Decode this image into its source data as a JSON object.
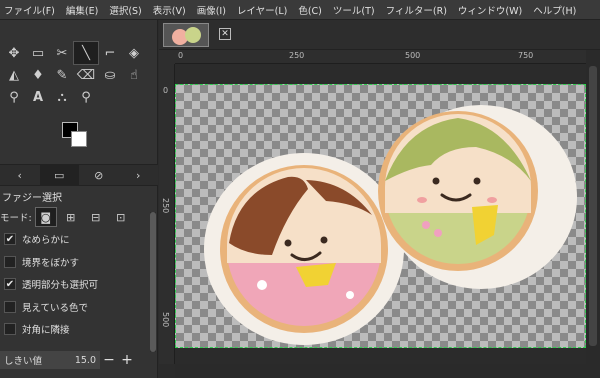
{
  "menubar": {
    "items": [
      "ファイル(F)",
      "編集(E)",
      "選択(S)",
      "表示(V)",
      "画像(I)",
      "レイヤー(L)",
      "色(C)",
      "ツール(T)",
      "フィルター(R)",
      "ウィンドウ(W)",
      "ヘルプ(H)"
    ]
  },
  "toolbox": {
    "tools": [
      [
        "move-tool-icon",
        "rect-select-tool-icon",
        "scissors-tool-icon",
        "measure-tool-icon",
        "crop-tool-icon",
        "transform-tool-icon"
      ],
      [
        "bucket-fill-tool-icon",
        "paintbrush-tool-icon",
        "pencil-tool-icon",
        "eraser-tool-icon",
        "clone-tool-icon",
        "smudge-tool-icon"
      ],
      [
        "paths-tool-icon",
        "text-tool-icon",
        "color-picker-tool-icon",
        "zoom-tool-icon"
      ]
    ],
    "active_tool": "measure-tool-icon"
  },
  "tool_options": {
    "title": "ファジー選択",
    "mode_label": "モード:",
    "checks": [
      {
        "label": "なめらかに",
        "checked": true
      },
      {
        "label": "境界をぼかす",
        "checked": false
      },
      {
        "label": "透明部分も選択可",
        "checked": true
      },
      {
        "label": "見えている色で",
        "checked": false
      },
      {
        "label": "対角に隣接",
        "checked": false
      }
    ],
    "threshold_label": "しきい値",
    "threshold_value": "15.0"
  },
  "ruler": {
    "top_ticks": [
      "0",
      "250",
      "500",
      "750"
    ],
    "left_ticks": [
      "0",
      "250",
      "500"
    ]
  },
  "colors": {
    "selection_border": "#2fcf4f"
  }
}
